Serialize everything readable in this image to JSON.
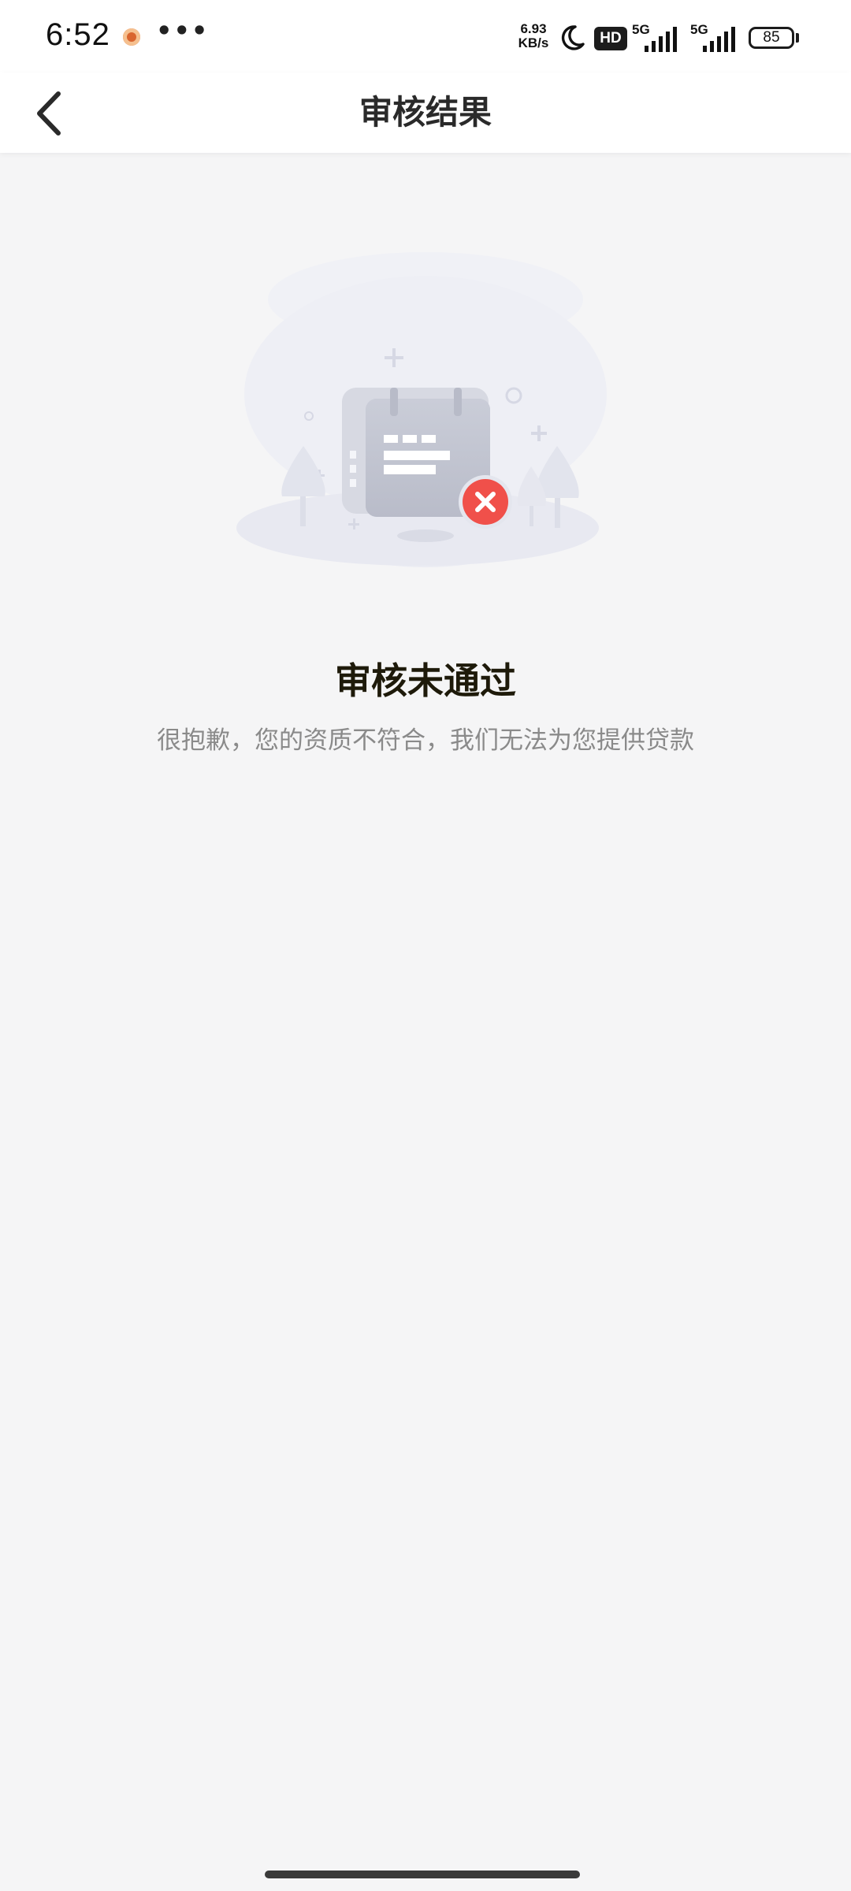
{
  "status_bar": {
    "time": "6:52",
    "dots": "•••",
    "net_speed_value": "6.93",
    "net_speed_unit": "KB/s",
    "hd_label": "HD",
    "sim1_label": "5G",
    "sim2_label": "5G",
    "battery_level": "85"
  },
  "nav": {
    "title": "审核结果"
  },
  "result": {
    "title": "审核未通过",
    "description": "很抱歉，您的资质不符合，我们无法为您提供贷款"
  },
  "colors": {
    "background": "#f5f5f6",
    "error_badge": "#f0504a",
    "title_text": "#1e1a0a",
    "description_text": "#8a8a8a"
  }
}
